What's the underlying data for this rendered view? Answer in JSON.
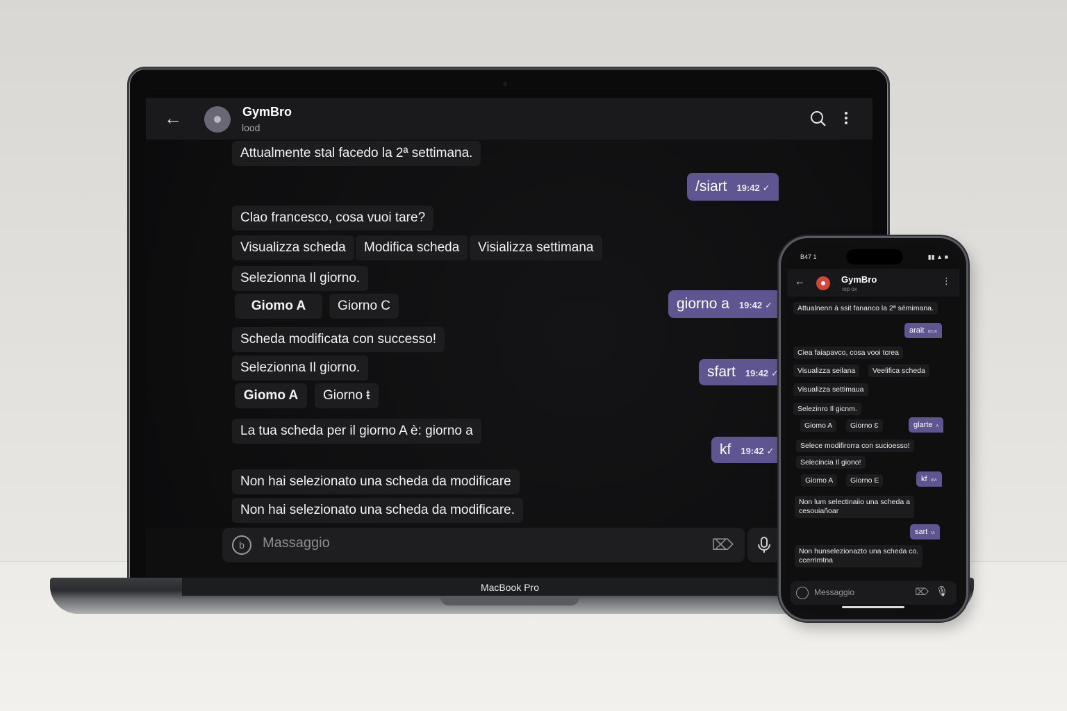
{
  "laptop": {
    "brand": "MacBook Pro",
    "chat": {
      "title": "GymBro",
      "subtitle": "lood",
      "incoming": [
        "Attualmente stal facedo la 2ª settimana.",
        "Clao francesco, cosa vuoi tare?",
        "Selezionna Il giorno.",
        "Scheda modificata con successo!",
        "Selezionna Il giorno.",
        "La tua scheda per il giorno A è: giorno a",
        "Non hai selezionato una scheda da modificare",
        "Non hai selezionato una scheda da modificare."
      ],
      "buttons_row1": [
        "Visualizza scheda",
        "Modifica scheda",
        "Visializza settimana"
      ],
      "buttons_row2": [
        "Giomo A",
        "Giorno C"
      ],
      "buttons_row3": [
        "Giomo A",
        "Giorno ŧ"
      ],
      "outgoing": [
        {
          "text": "/siart",
          "time": "19:42"
        },
        {
          "text": "giorno a",
          "time": "19:42"
        },
        {
          "text": "sfart",
          "time": "19:42"
        },
        {
          "text": "kf",
          "time": "19:42"
        }
      ],
      "composer_placeholder": "Massaggio"
    }
  },
  "phone": {
    "status_time": "B47 1",
    "chat": {
      "title": "GymBro",
      "subtitle": "ıop ox",
      "incoming": [
        "Attualnenn à ssit fananco la 2ª sémimana.",
        "Ciea faiapavco, cosa vooi tcrea",
        "Visualizza settimaua",
        "Selezinro Il gicnm.",
        "Selece modifirorra con sucioesso!",
        "Selecincia Il giono!",
        "Non lum selectinaiio una scheda a",
        "cesouiañoar",
        "Non hunselezionazto una scheda co.",
        "ccerrimtna"
      ],
      "buttons_a": [
        "Visualizza seilana",
        "Veelifica scheda"
      ],
      "buttons_b": [
        "Giomo A",
        "Giorno Ɛ"
      ],
      "buttons_c": [
        "Giomo A",
        "Giorno E"
      ],
      "outgoing": [
        {
          "text": "arait",
          "time": "ıa:ɹʌ"
        },
        {
          "text": "glarte",
          "time": "ʌ"
        },
        {
          "text": "kf",
          "time": "ıʌʌ"
        },
        {
          "text": "sart",
          "time": "ıʌ"
        }
      ],
      "composer_placeholder": "Messaggio"
    }
  }
}
